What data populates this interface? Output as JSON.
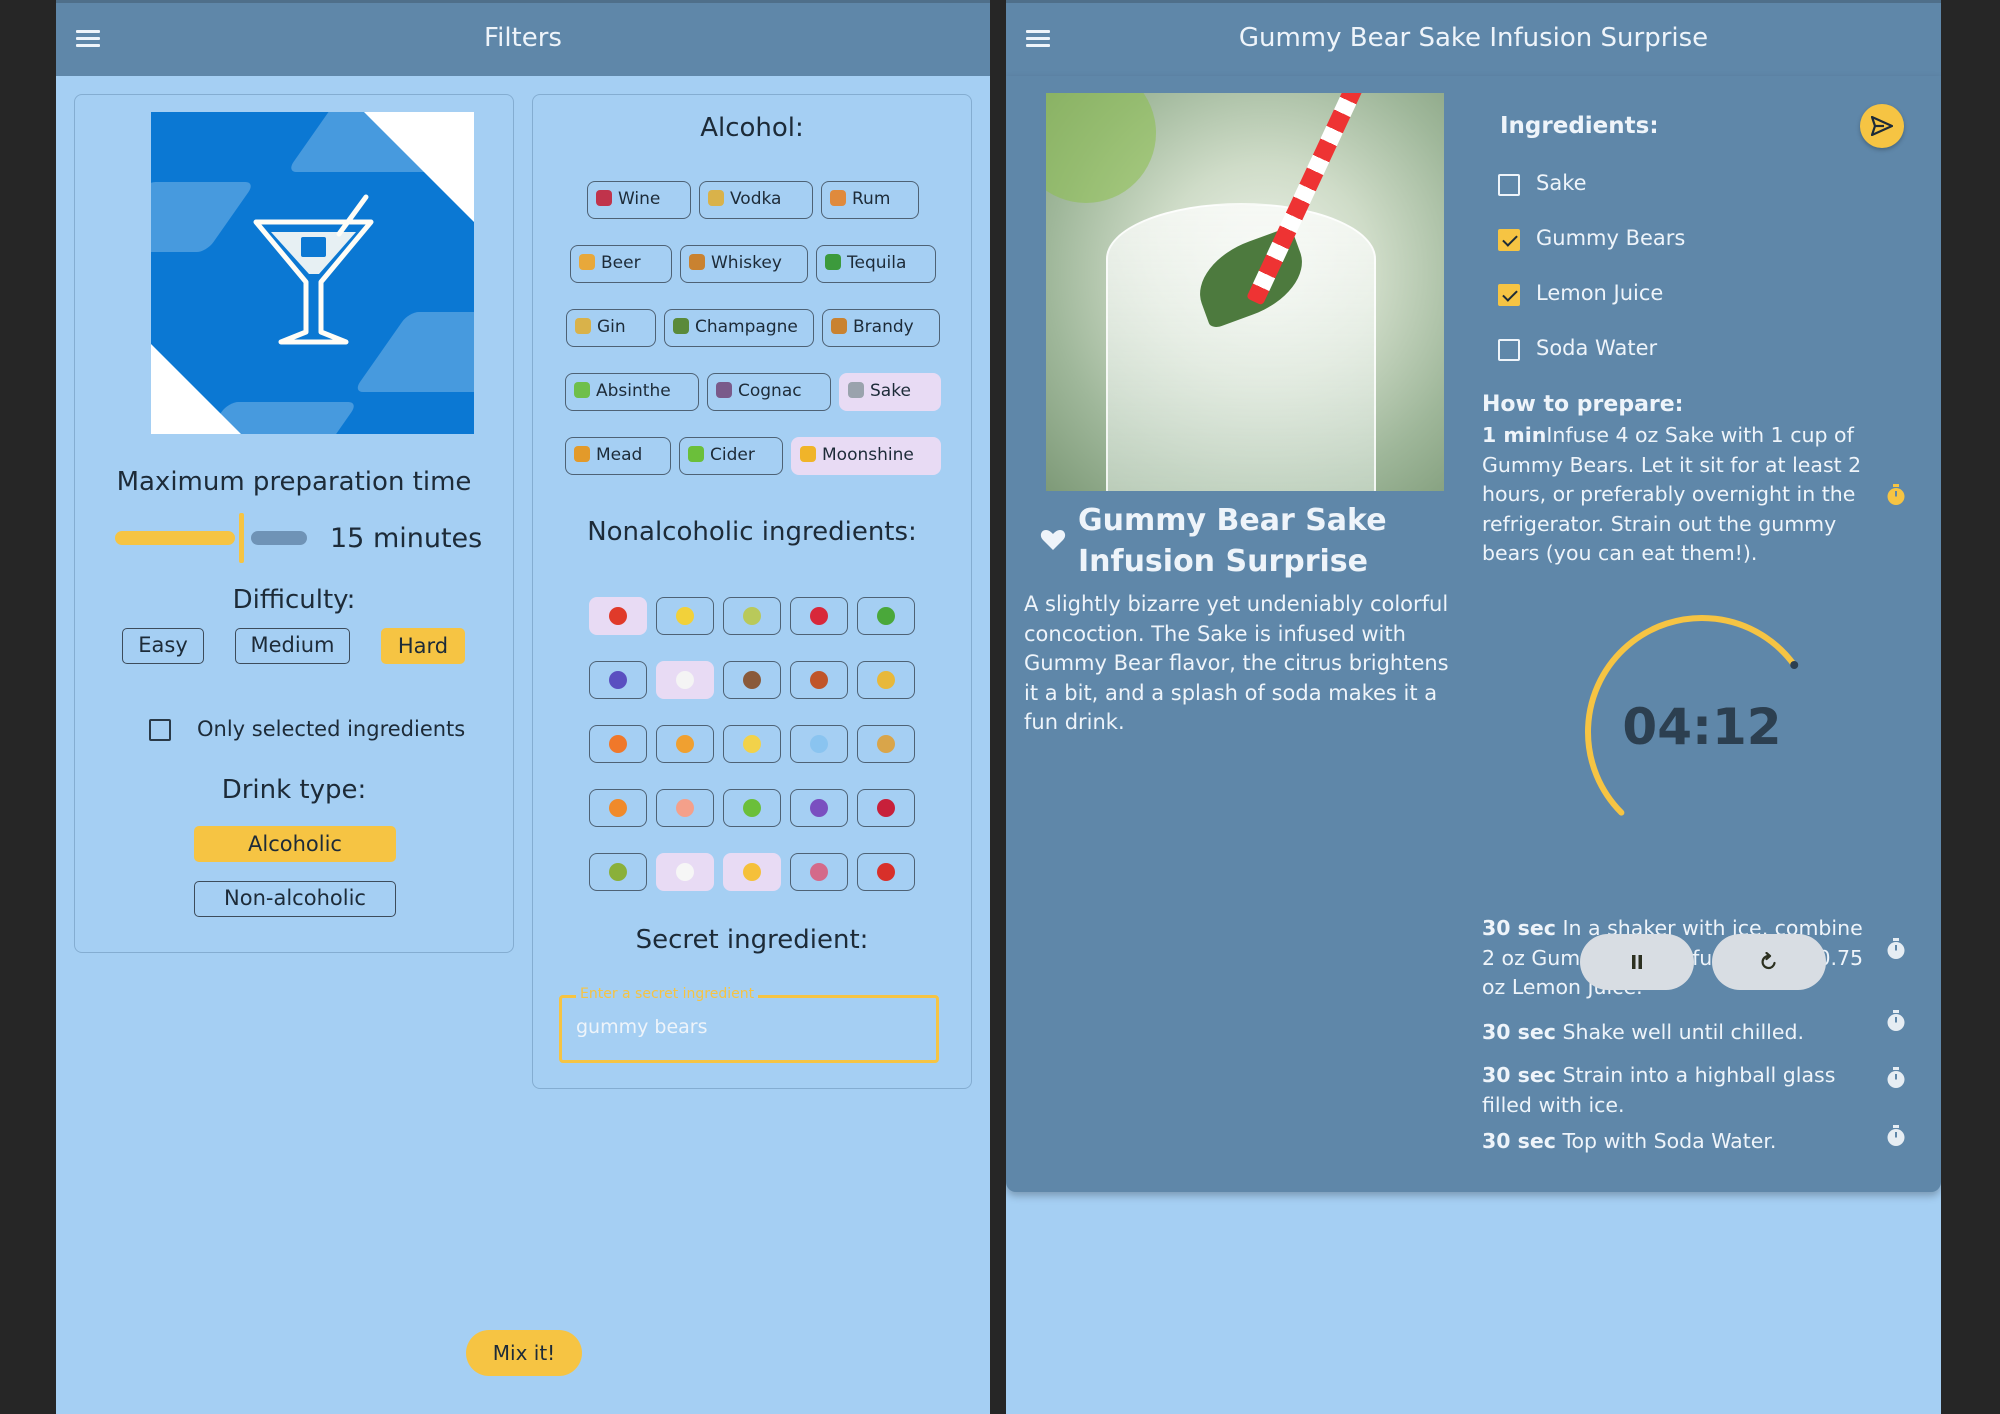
{
  "left_panel": {
    "title": "Filters",
    "prep_time": {
      "label": "Maximum preparation time",
      "value": "15 minutes",
      "level": 0.65
    },
    "difficulty": {
      "label": "Difficulty:",
      "options": [
        "Easy",
        "Medium",
        "Hard"
      ],
      "selected": "Hard"
    },
    "only_selected_label": "Only selected ingredients",
    "drink_type": {
      "label": "Drink type:",
      "options": [
        "Alcoholic",
        "Non-alcoholic"
      ],
      "selected": "Alcoholic"
    },
    "alcohol": {
      "label": "Alcohol:",
      "chips": [
        {
          "label": "Wine",
          "icon": "wine-glass-icon",
          "color": "#c0334b"
        },
        {
          "label": "Vodka",
          "icon": "cocktail-icon",
          "color": "#d9b24a"
        },
        {
          "label": "Rum",
          "icon": "tropical-drink-icon",
          "color": "#e08a3c"
        },
        {
          "label": "Beer",
          "icon": "beer-mug-icon",
          "color": "#e8a83a"
        },
        {
          "label": "Whiskey",
          "icon": "tumbler-icon",
          "color": "#c98230"
        },
        {
          "label": "Tequila",
          "icon": "cactus-icon",
          "color": "#3c9a3c"
        },
        {
          "label": "Gin",
          "icon": "cocktail-icon",
          "color": "#d9b24a"
        },
        {
          "label": "Champagne",
          "icon": "bottle-icon",
          "color": "#5a8a3a"
        },
        {
          "label": "Brandy",
          "icon": "tumbler-icon",
          "color": "#c98230"
        },
        {
          "label": "Absinthe",
          "icon": "test-tube-icon",
          "color": "#6fbf4a"
        },
        {
          "label": "Cognac",
          "icon": "pipette-icon",
          "color": "#7a5a8a"
        },
        {
          "label": "Sake",
          "icon": "sake-icon",
          "color": "#9aa3ad"
        },
        {
          "label": "Mead",
          "icon": "honey-pot-icon",
          "color": "#e39a2a"
        },
        {
          "label": "Cider",
          "icon": "green-apple-icon",
          "color": "#6bbf3a"
        },
        {
          "label": "Moonshine",
          "icon": "moon-icon",
          "color": "#f0b429"
        }
      ],
      "selected": [
        "Sake",
        "Moonshine"
      ]
    },
    "nonalcoholic": {
      "label": "Nonalcoholic ingredients:",
      "items": [
        {
          "icon": "tomato-icon",
          "color": "#e03a2a",
          "selected": true
        },
        {
          "icon": "lemon-icon",
          "color": "#f2d13a",
          "selected": false
        },
        {
          "icon": "melon-icon",
          "color": "#b9c95a",
          "selected": false
        },
        {
          "icon": "strawberry-icon",
          "color": "#d8283a",
          "selected": false
        },
        {
          "icon": "cucumber-icon",
          "color": "#4aa83a",
          "selected": false
        },
        {
          "icon": "blueberries-icon",
          "color": "#5a4fc0",
          "selected": false
        },
        {
          "icon": "milk-icon",
          "color": "#f4f4f4",
          "selected": true
        },
        {
          "icon": "coconut-icon",
          "color": "#8a5a3a",
          "selected": false
        },
        {
          "icon": "chestnut-icon",
          "color": "#c0552a",
          "selected": false
        },
        {
          "icon": "pineapple-icon",
          "color": "#e8b83a",
          "selected": false
        },
        {
          "icon": "orange-icon",
          "color": "#f0782a",
          "selected": false
        },
        {
          "icon": "mango-icon",
          "color": "#f0a030",
          "selected": false
        },
        {
          "icon": "banana-icon",
          "color": "#f2d24a",
          "selected": false
        },
        {
          "icon": "ice-cube-icon",
          "color": "#8ac4f0",
          "selected": false
        },
        {
          "icon": "ginger-icon",
          "color": "#d9a54a",
          "selected": false
        },
        {
          "icon": "tangerine-icon",
          "color": "#f08a2a",
          "selected": false
        },
        {
          "icon": "peach-icon",
          "color": "#f4a08a",
          "selected": false
        },
        {
          "icon": "green-apple-icon",
          "color": "#6bbf3a",
          "selected": false
        },
        {
          "icon": "grapes-icon",
          "color": "#7a4fc0",
          "selected": false
        },
        {
          "icon": "cherries-icon",
          "color": "#c8203a",
          "selected": false
        },
        {
          "icon": "kiwi-icon",
          "color": "#8ab03a",
          "selected": false
        },
        {
          "icon": "egg-icon",
          "color": "#f6f6f6",
          "selected": true
        },
        {
          "icon": "cheese-icon",
          "color": "#f5c03a",
          "selected": true
        },
        {
          "icon": "ice-cream-icon",
          "color": "#d46a8a",
          "selected": false
        },
        {
          "icon": "chili-icon",
          "color": "#d8302a",
          "selected": false
        }
      ]
    },
    "secret": {
      "label": "Secret ingredient:",
      "field_label": "Enter a secret ingredient",
      "value": "gummy bears"
    },
    "mix_button": "Mix it!"
  },
  "right_panel": {
    "title": "Gummy Bear Sake Infusion Surprise",
    "recipe_title": "Gummy Bear Sake Infusion Surprise",
    "description": "A slightly bizarre yet undeniably colorful concoction. The Sake is infused with Gummy Bear flavor, the citrus brightens it a bit, and a splash of soda makes it a fun drink.",
    "ingredients_label": "Ingredients:",
    "ingredients": [
      {
        "name": "Sake",
        "checked": false
      },
      {
        "name": "Gummy Bears",
        "checked": true
      },
      {
        "name": "Lemon Juice",
        "checked": true
      },
      {
        "name": "Soda Water",
        "checked": false
      }
    ],
    "prepare_label": "How to prepare:",
    "steps": [
      {
        "time": "1 min",
        "text": "Infuse 4 oz Sake with 1 cup of Gummy Bears. Let it sit for at least 2 hours, or preferably overnight in the refrigerator. Strain out the gummy bears (you can eat them!)."
      },
      {
        "time": "30 sec",
        "text": " In a shaker with ice, combine 2 oz Gummy Bear Infused Sake, 0.75 oz Lemon Juice."
      },
      {
        "time": "30 sec",
        "text": " Shake well until chilled."
      },
      {
        "time": "30 sec",
        "text": " Strain into a highball glass filled with ice."
      },
      {
        "time": "30 sec",
        "text": " Top with Soda Water."
      }
    ],
    "timer": {
      "display": "04:12",
      "progress": 0.7
    }
  },
  "colors": {
    "accent": "#f6c443",
    "appbar": "#5f87a9",
    "background": "#a5cff3",
    "chip_selected": "#e8dbf4"
  }
}
